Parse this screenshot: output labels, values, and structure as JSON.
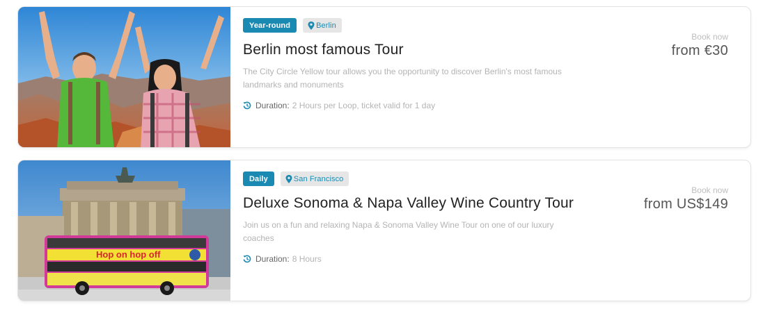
{
  "tours": [
    {
      "season": "Year-round",
      "location": "Berlin",
      "title": "Berlin most famous Tour",
      "description": "The City Circle Yellow tour allows you the opportunity to discover Berlin's most famous landmarks and monuments",
      "duration_label": "Duration:",
      "duration_value": "2 Hours per Loop, ticket valid for 1 day",
      "book_label": "Book now",
      "price": "from €30"
    },
    {
      "season": "Daily",
      "location": "San Francisco",
      "title": "Deluxe Sonoma & Napa Valley Wine Country Tour",
      "description": "Join us on a fun and relaxing Napa & Sonoma Valley Wine Tour on one of our luxury coaches",
      "duration_label": "Duration:",
      "duration_value": "8 Hours",
      "book_label": "Book now",
      "price": "from US$149"
    }
  ],
  "bus_sign": "Hop on hop off",
  "colors": {
    "accent": "#1a8ab3",
    "badge_gray": "#e6e6e6"
  },
  "icons": {
    "location": "map-pin-icon",
    "duration": "history-clock-icon"
  }
}
